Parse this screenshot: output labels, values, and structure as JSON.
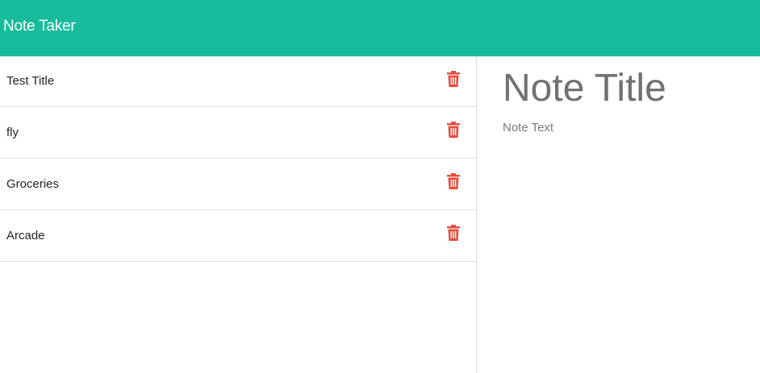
{
  "app": {
    "title": "Note Taker"
  },
  "colors": {
    "navbar": "#18bc9c",
    "delete_icon": "#e74c3c"
  },
  "notes": [
    {
      "title": "Test Title",
      "icon": "trash-icon"
    },
    {
      "title": "fly",
      "icon": "trash-icon"
    },
    {
      "title": "Groceries",
      "icon": "trash-icon"
    },
    {
      "title": "Arcade",
      "icon": "trash-icon"
    }
  ],
  "editor": {
    "title_placeholder": "Note Title",
    "text_placeholder": "Note Text"
  }
}
